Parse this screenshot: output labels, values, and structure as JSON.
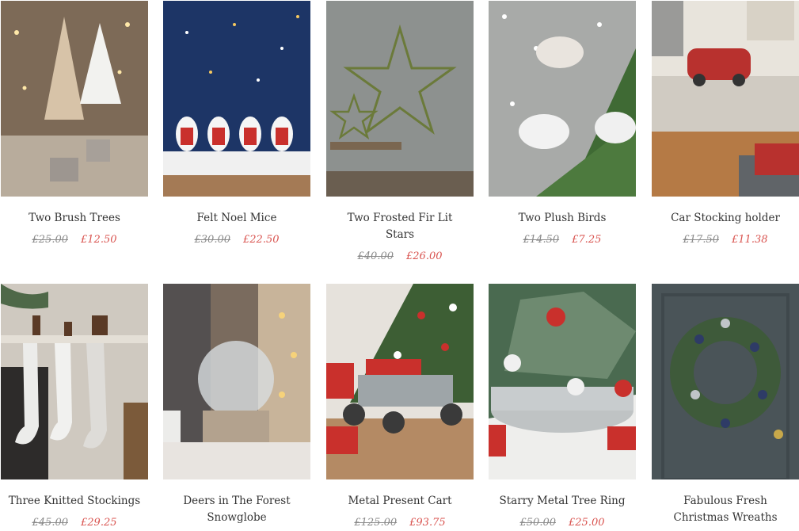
{
  "products": [
    {
      "title": "Two Brush Trees",
      "old_price": "£25.00",
      "new_price": "£12.50",
      "image": "brush-trees-photo"
    },
    {
      "title": "Felt Noel Mice",
      "old_price": "£30.00",
      "new_price": "£22.50",
      "image": "noel-mice-photo"
    },
    {
      "title": "Two Frosted Fir Lit Stars",
      "old_price": "£40.00",
      "new_price": "£26.00",
      "image": "lit-stars-photo"
    },
    {
      "title": "Two Plush Birds",
      "old_price": "£14.50",
      "new_price": "£7.25",
      "image": "plush-birds-photo"
    },
    {
      "title": "Car Stocking holder",
      "old_price": "£17.50",
      "new_price": "£11.38",
      "image": "car-stocking-holder-photo"
    },
    {
      "title": "Three Knitted Stockings",
      "old_price": "£45.00",
      "new_price": "£29.25",
      "image": "knitted-stockings-photo"
    },
    {
      "title": "Deers in The Forest Snowglobe",
      "old_price": "",
      "new_price": "",
      "image": "snowglobe-photo"
    },
    {
      "title": "Metal Present Cart",
      "old_price": "£125.00",
      "new_price": "£93.75",
      "image": "present-cart-photo"
    },
    {
      "title": "Starry Metal Tree Ring",
      "old_price": "£50.00",
      "new_price": "£25.00",
      "image": "tree-ring-photo"
    },
    {
      "title": "Fabulous Fresh Christmas Wreaths",
      "old_price": "",
      "new_price": "",
      "image": "wreath-photo"
    }
  ],
  "colors": {
    "sale_price": "#d9534f",
    "old_price": "#8a8a8a",
    "title": "#333333"
  }
}
